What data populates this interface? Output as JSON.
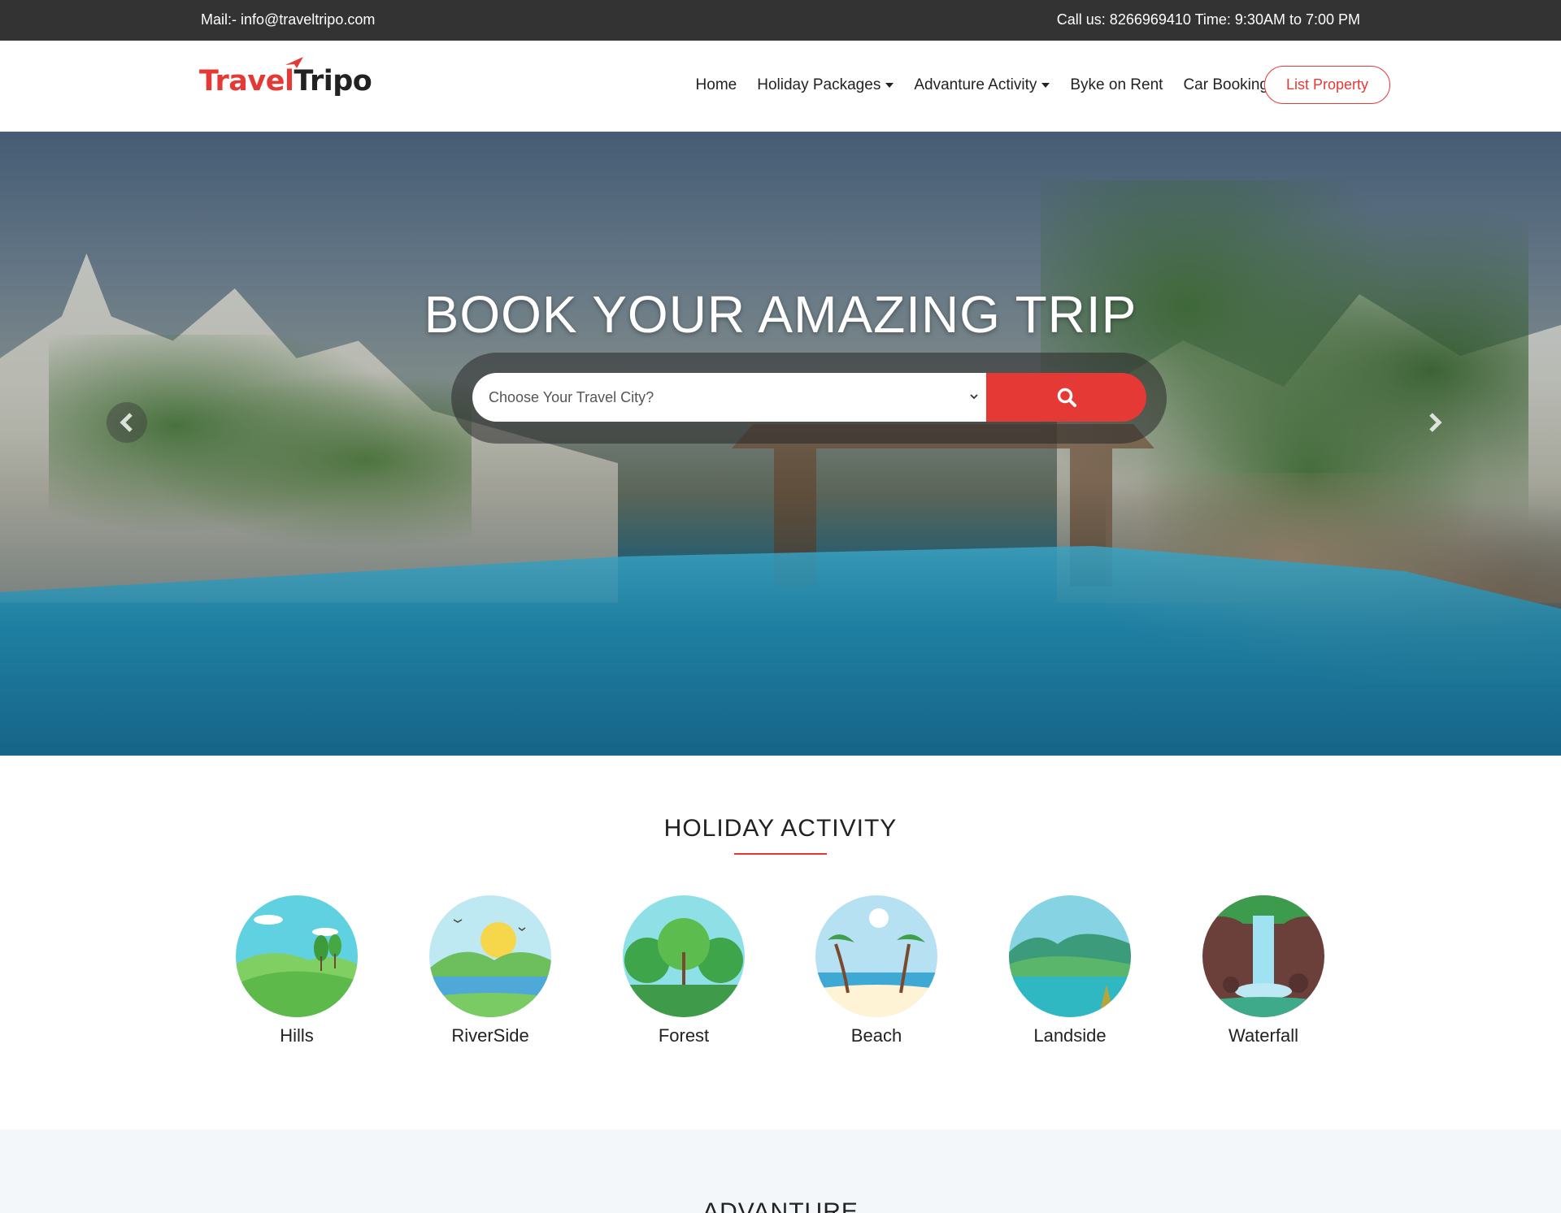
{
  "topbar": {
    "mail": "Mail:- info@traveltripo.com",
    "call": "Call us: 8266969410 Time: 9:30AM to 7:00 PM"
  },
  "logo": {
    "part1": "Travel",
    "part2": "Tripo"
  },
  "nav": {
    "items": [
      {
        "label": "Home"
      },
      {
        "label": "Holiday Packages"
      },
      {
        "label": "Advanture Activity"
      },
      {
        "label": "Byke on Rent"
      },
      {
        "label": "Car Booking"
      }
    ],
    "list_property": "List Property"
  },
  "hero": {
    "title": "BOOK YOUR AMAZING TRIP",
    "search_placeholder": "Choose Your Travel City?",
    "icons": {
      "search": "search-icon",
      "prev": "chevron-left-icon",
      "next": "chevron-right-icon"
    }
  },
  "holiday": {
    "title": "HOLIDAY ACTIVITY",
    "activities": [
      {
        "label": "Hills"
      },
      {
        "label": "RiverSide"
      },
      {
        "label": "Forest"
      },
      {
        "label": "Beach"
      },
      {
        "label": "Landside"
      },
      {
        "label": "Waterfall"
      }
    ]
  },
  "adventure": {
    "title": "ADVANTURE"
  },
  "colors": {
    "accent": "#e53935",
    "topbar": "#333333",
    "band": "#f4f7fa"
  }
}
